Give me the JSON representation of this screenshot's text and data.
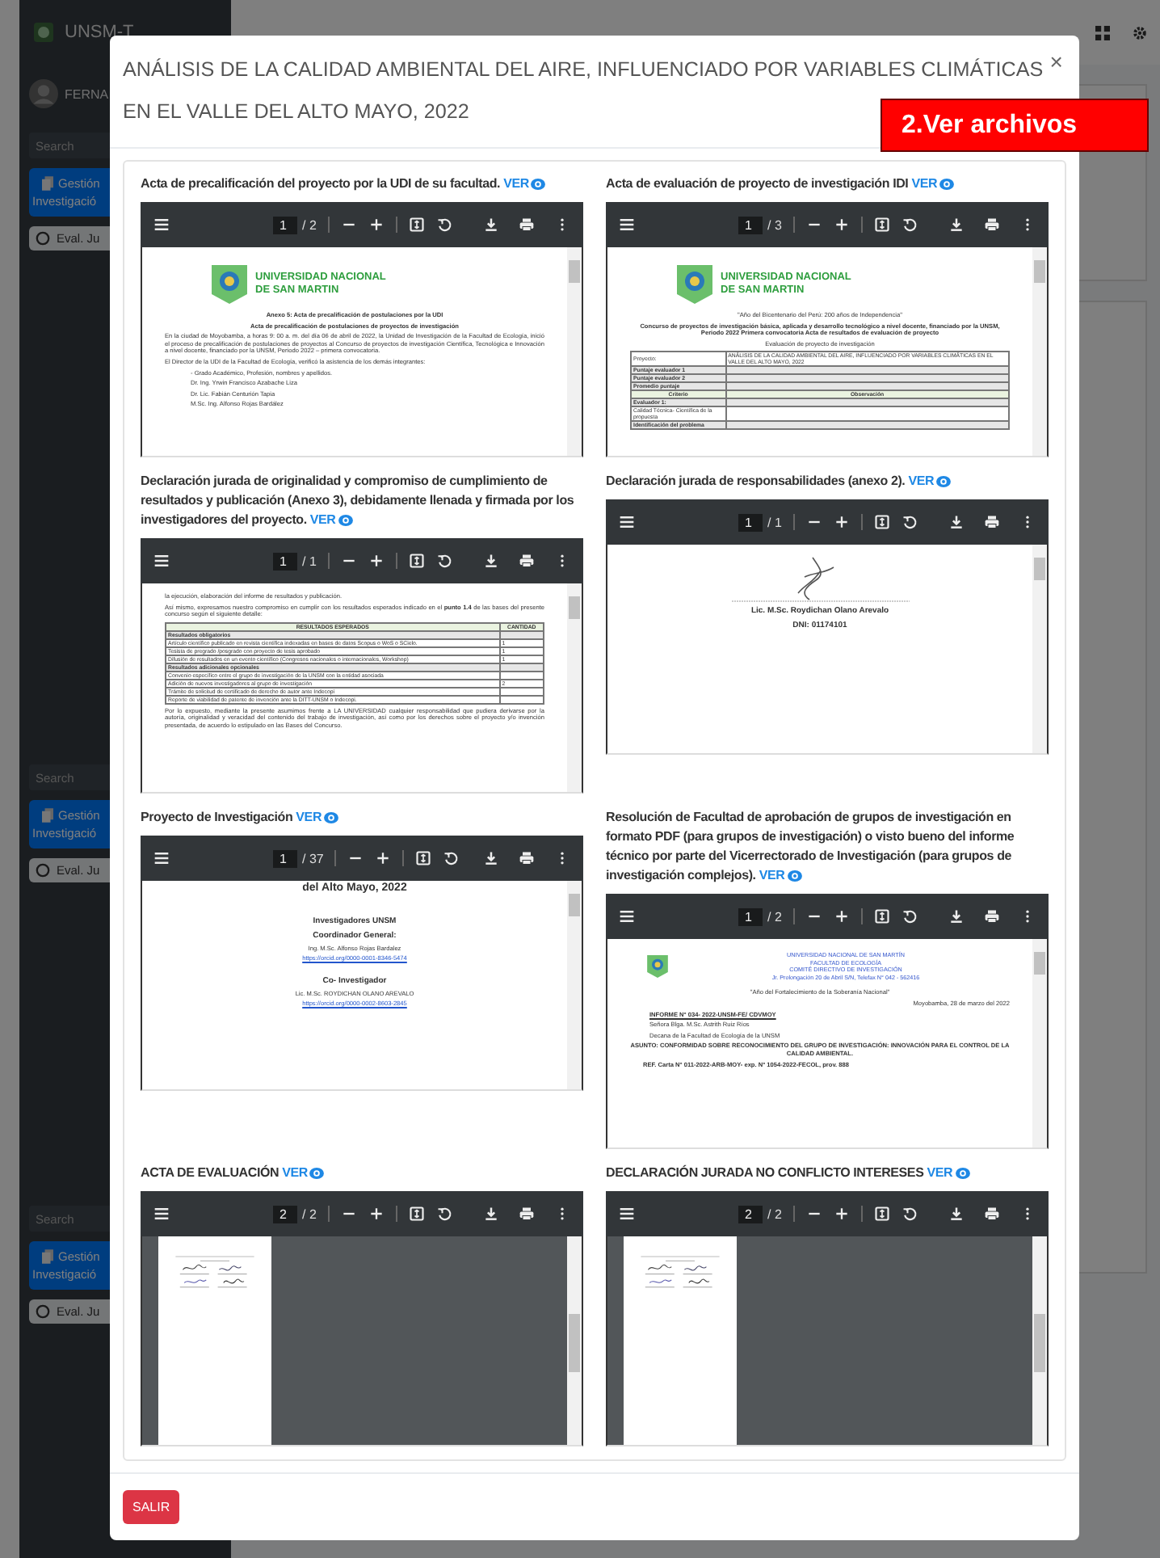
{
  "background": {
    "brand": "UNSM-T",
    "user": "FERNA",
    "sidebar_groups": [
      {
        "search_placeholder": "Search",
        "menu_item": [
          "Gestión",
          "Investigació"
        ],
        "sub_item": "Eval. Ju"
      },
      {
        "search_placeholder": "Search",
        "menu_item": [
          "Gestión",
          "Investigació"
        ],
        "sub_item": "Eval. Ju"
      },
      {
        "search_placeholder": "Search",
        "menu_item": [
          "Gestión",
          "Investigació"
        ],
        "sub_item": "Eval. Ju"
      }
    ]
  },
  "modal": {
    "title_lines": [
      "ANÁLISIS DE LA CALIDAD AMBIENTAL DEL AIRE, INFLUENCIADO POR VARIABLES CLIMÁTICAS",
      "EN EL VALLE DEL ALTO MAYO, 2022"
    ],
    "close": "×",
    "annotation": "2.Ver archivos",
    "documents": [
      {
        "label": "Acta de precalificación del proyecto por la UDI de su facultad.",
        "link": "VER",
        "page": "1",
        "pages": "/ 2",
        "preview": {
          "kind": "letterhead",
          "header": [
            "UNIVERSIDAD NACIONAL",
            "DE SAN MARTIN"
          ],
          "lines": [
            {
              "kind": "heading",
              "text": "Anexo 5: Acta de precalificación de postulaciones por la UDI"
            },
            {
              "kind": "heading",
              "text": "Acta de precalificación de postulaciones de proyectos de investigación"
            },
            {
              "kind": "text",
              "text": "En la ciudad de Moyobamba, a horas 9: 00 a. m. del día 06 de abril de 2022, la Unidad de Investigación de la Facultad de Ecología, inició el proceso de precalificación de postulaciones de proyectos al Concurso de proyectos de investigación Científica, Tecnológica e Innovación a nivel docente, financiado por la UNSM, Periodo 2022 – primera convocatoria."
            },
            {
              "kind": "text",
              "text": "El Director de la UDI de la Facultad de Ecología, verificó la asistencia de los demás integrantes:"
            },
            {
              "kind": "indent",
              "text": "-   Grado Académico, Profesión, nombres y apellidos."
            },
            {
              "kind": "indent",
              "text": "Dr. Ing. Yrwin Francisco Azabache Liza"
            },
            {
              "kind": "indent",
              "text": "Dr. Lic. Fabián Centurión Tapia"
            },
            {
              "kind": "indent",
              "text": "M.Sc. Ing. Alfonso Rojas Bardález"
            }
          ]
        }
      },
      {
        "label": "Acta de evaluación de proyecto de investigación IDI",
        "link": "VER",
        "page": "1",
        "pages": "/ 3",
        "preview": {
          "kind": "letterhead",
          "header": [
            "UNIVERSIDAD NACIONAL",
            "DE SAN MARTIN"
          ],
          "lines": [
            {
              "kind": "center",
              "text": "\"Año del Bicentenario del Perú: 200 años de Independencia\""
            },
            {
              "kind": "heading",
              "text": "Concurso de proyectos de investigación básica, aplicada y desarrollo tecnológico a nivel docente, financiado por la UNSM, Periodo 2022 Primera convocatoria Acta de resultados de evaluación de proyecto"
            },
            {
              "kind": "center",
              "text": "Evaluación de proyecto de investigación"
            },
            {
              "kind": "table",
              "rows": [
                {
                  "kind": "item",
                  "cells": [
                    "Proyecto:",
                    "ANÁLISIS DE LA CALIDAD AMBIENTAL DEL AIRE, INFLUENCIADO POR VARIABLES CLIMÁTICAS EN EL VALLE DEL ALTO MAYO, 2022"
                  ]
                },
                {
                  "kind": "section",
                  "cells": [
                    "Puntaje evaluador 1",
                    ""
                  ]
                },
                {
                  "kind": "section",
                  "cells": [
                    "Puntaje evaluador 2",
                    ""
                  ]
                },
                {
                  "kind": "section",
                  "cells": [
                    "Promedio puntaje",
                    ""
                  ]
                },
                {
                  "kind": "head",
                  "cells": [
                    "Criterio",
                    "Observación"
                  ]
                },
                {
                  "kind": "section",
                  "cells": [
                    "Evaluador 1:",
                    ""
                  ]
                },
                {
                  "kind": "item",
                  "cells": [
                    "Calidad Técnica- Científica de la propuesta",
                    ""
                  ]
                },
                {
                  "kind": "section",
                  "cells": [
                    "Identificación del problema",
                    ""
                  ]
                }
              ]
            }
          ]
        }
      },
      {
        "label": "Declaración jurada de originalidad y compromiso de cumplimiento de resultados y publicación (Anexo 3), debidamente llenada y firmada por los investigadores del proyecto.",
        "link": "VER",
        "page": "1",
        "pages": "/ 1",
        "preview": {
          "kind": "plain",
          "lines": [
            {
              "kind": "text",
              "text": "la ejecución, elaboración del informe de resultados y publicación."
            },
            {
              "kind": "text",
              "text": "Así mismo, expresamos nuestro compromiso en cumplir con los resultados esperados indicado en el **punto 1.4** de las bases del presente concurso según el siguiente detalle:"
            },
            {
              "kind": "table",
              "rows": [
                {
                  "kind": "head",
                  "cells": [
                    "RESULTADOS ESPERADOS",
                    "CANTIDAD"
                  ]
                },
                {
                  "kind": "section",
                  "cells": [
                    "Resultados obligatorios",
                    ""
                  ]
                },
                {
                  "kind": "item",
                  "cells": [
                    "Artículo científico publicado en revista científica indexadas en bases de datos Scopus o WoS o SCielo.",
                    "1"
                  ]
                },
                {
                  "kind": "item",
                  "cells": [
                    "Tesista de pregrado /posgrado con proyecto de tesis aprobado",
                    "1"
                  ]
                },
                {
                  "kind": "item",
                  "cells": [
                    "Difusión de resultados en un evento científico (Congresos nacionales o internacionales, Workshop)",
                    "1"
                  ]
                },
                {
                  "kind": "section",
                  "cells": [
                    "Resultados adicionales opcionales",
                    ""
                  ]
                },
                {
                  "kind": "item",
                  "cells": [
                    "Convenio específico entre el grupo de investigación de la UNSM con la entidad asociada",
                    ""
                  ]
                },
                {
                  "kind": "item",
                  "cells": [
                    "Adición de nuevos investigadores al grupo de investigación",
                    "2"
                  ]
                },
                {
                  "kind": "item",
                  "cells": [
                    "Trámite de solicitud de certificado de derecho de autor ante Indecopi",
                    ""
                  ]
                },
                {
                  "kind": "item",
                  "cells": [
                    "Reporte de viabilidad de patente de invención ante la DITT-UNSM o Indecopi.",
                    ""
                  ]
                }
              ]
            },
            {
              "kind": "text",
              "text": "Por lo expuesto, mediante la presente asumimos frente a LA UNIVERSIDAD cualquier responsabilidad que pudiera derivarse por la autoría, originalidad y veracidad del contenido del trabajo de investigación, así como por los derechos sobre el proyecto y/o invención presentada, de acuerdo lo estipulado en las Bases del Concurso."
            }
          ]
        }
      },
      {
        "label": "Declaración jurada de responsabilidades (anexo 2).",
        "link": "VER",
        "page": "1",
        "pages": "/ 1",
        "preview": {
          "kind": "plain",
          "lines": [
            {
              "kind": "signature"
            },
            {
              "kind": "center-bold",
              "text": "Lic. M.Sc. Roydichan Olano Arevalo"
            },
            {
              "kind": "center-bold",
              "text": "DNI: 01174101"
            }
          ]
        }
      },
      {
        "label": "Proyecto de Investigación",
        "link": "VER",
        "page": "1",
        "pages": "/ 37",
        "preview": {
          "kind": "plain",
          "lines": [
            {
              "kind": "big",
              "text": "del Alto Mayo, 2022"
            },
            {
              "kind": "center-bold",
              "text": "Investigadores UNSM"
            },
            {
              "kind": "center-bold",
              "text": "Coordinador General:"
            },
            {
              "kind": "center",
              "text": "Ing. M.Sc. Alfonso Rojas Bardalez"
            },
            {
              "kind": "link",
              "text": "https://orcid.org/0000-0001-8346-5474"
            },
            {
              "kind": "center-bold",
              "text": "Co- Investigador"
            },
            {
              "kind": "center",
              "text": "Lic. M.Sc. ROYDICHAN OLANO AREVALO"
            },
            {
              "kind": "link",
              "text": "https://orcid.org/0000-0002-8603-2845"
            }
          ]
        }
      },
      {
        "label": "Resolución de Facultad de aprobación de grupos de investigación en formato PDF (para grupos de investigación) o visto bueno del informe técnico por parte del Vicerrectorado de Investigación (para grupos de investigación complejos).",
        "link": "VER",
        "page": "1",
        "pages": "/ 2",
        "preview": {
          "kind": "memo",
          "header": [
            "UNIVERSIDAD NACIONAL DE SAN MARTÍN",
            "FACULTAD DE ECOLOGÍA",
            "COMITÉ DIRECTIVO DE INVESTIGACIÓN",
            "Jr. Prolongación 20 de Abril S/N, Telefax N° 042 - 562416"
          ],
          "lines": [
            {
              "kind": "center",
              "text": "\"Año del Fortalecimiento de la Soberanía Nacional\""
            },
            {
              "kind": "right",
              "text": "Moyobamba, 28 de marzo del 2022"
            },
            {
              "kind": "underline",
              "text": "INFORME N° 034- 2022-UNSM-FE/ CDVMOY"
            },
            {
              "kind": "plainline",
              "text": "Señora Blga. M.Sc. Astrith Ruiz Ríos"
            },
            {
              "kind": "plainline",
              "text": "Decana de la Facultad de Ecología de la UNSM"
            },
            {
              "kind": "heading",
              "text": "ASUNTO: CONFORMIDAD SOBRE RECONOCIMIENTO DEL GRUPO DE INVESTIGACIÓN: INNOVACIÓN PARA EL CONTROL DE LA CALIDAD AMBIENTAL."
            },
            {
              "kind": "bold",
              "text": "REF. Carta N° 011-2022-ARB-MOY- exp. N° 1054-2022-FECOL, prov. 888"
            }
          ]
        }
      },
      {
        "label": "ACTA DE EVALUACIÓN",
        "link": "VER",
        "page": "2",
        "pages": "/ 2",
        "preview": {
          "kind": "scan"
        }
      },
      {
        "label": "DECLARACIÓN JURADA NO CONFLICTO INTERESES",
        "link": "VER",
        "page": "2",
        "pages": "/ 2",
        "preview": {
          "kind": "scan"
        }
      }
    ],
    "buttons": [
      "SALIR"
    ]
  }
}
